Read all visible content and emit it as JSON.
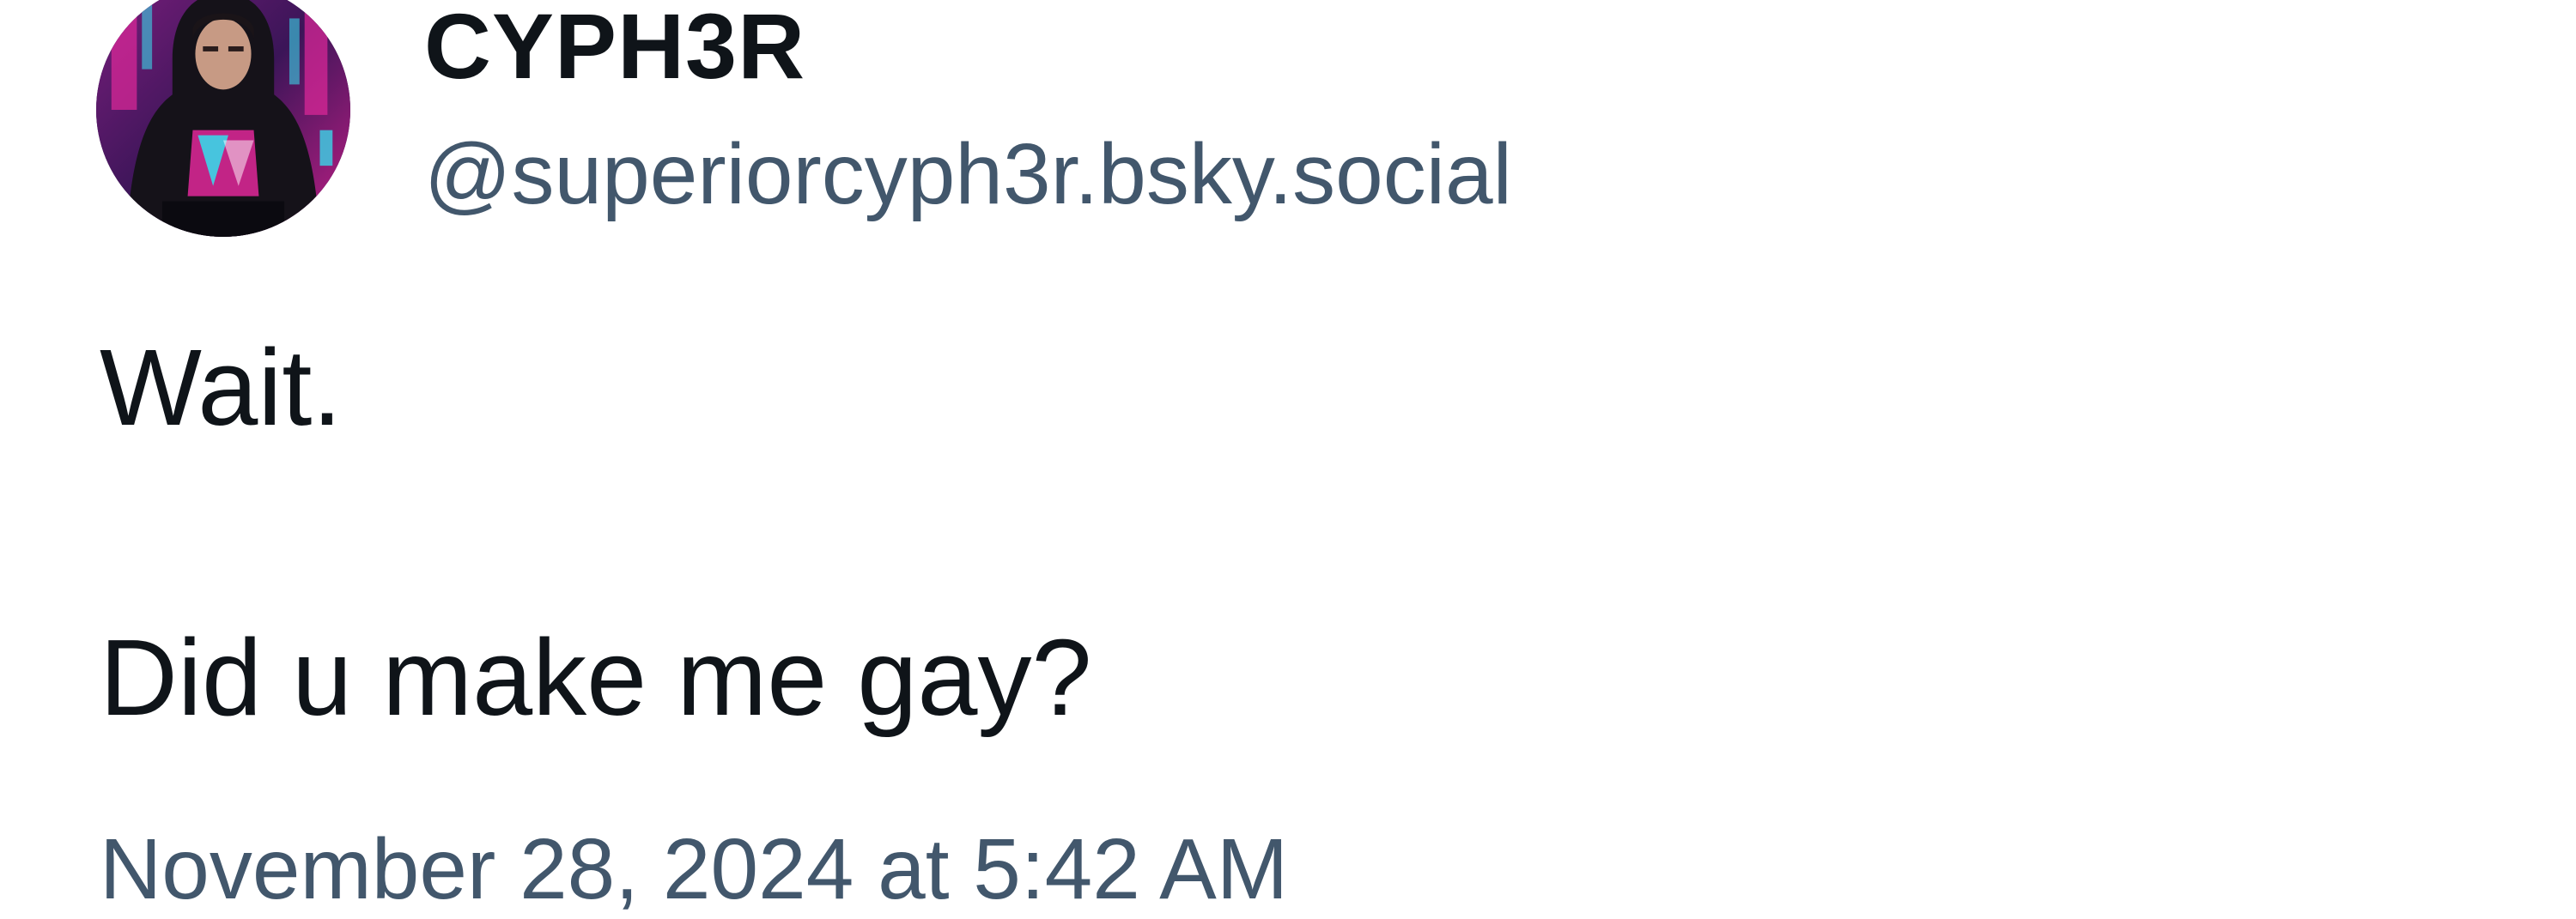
{
  "post": {
    "author": {
      "display_name": "CYPH3R",
      "handle": "@superiorcyph3r.bsky.social",
      "avatar_icon": "avatar-hooded-figure-icon"
    },
    "text_lines": [
      "Wait.",
      "Did u make me gay?"
    ],
    "timestamp": "November 28, 2024 at 5:42 AM"
  },
  "colors": {
    "text_primary": "#0f1419",
    "text_secondary": "#42576c",
    "background": "#ffffff",
    "avatar_accent_pink": "#e0289a",
    "avatar_accent_cyan": "#3ad6e8"
  }
}
